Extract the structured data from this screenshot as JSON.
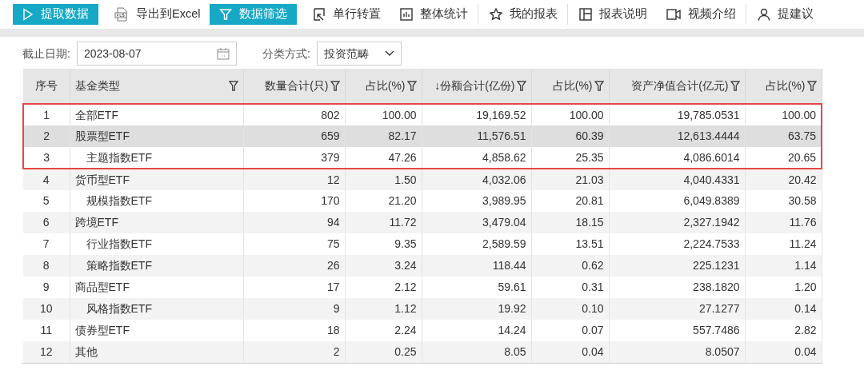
{
  "toolbar": [
    {
      "label": "提取数据",
      "kind": "primary",
      "divider_after": false
    },
    {
      "label": "导出到Excel",
      "kind": "plain",
      "divider_after": false
    },
    {
      "label": "数据筛选",
      "kind": "primary",
      "divider_after": false
    },
    {
      "label": "单行转置",
      "kind": "plain",
      "divider_after": false
    },
    {
      "label": "整体统计",
      "kind": "plain",
      "divider_after": true
    },
    {
      "label": "我的报表",
      "kind": "plain",
      "divider_after": true
    },
    {
      "label": "报表说明",
      "kind": "plain",
      "divider_after": false
    },
    {
      "label": "视频介绍",
      "kind": "plain",
      "divider_after": true
    },
    {
      "label": "提建议",
      "kind": "plain",
      "divider_after": false
    }
  ],
  "filters": {
    "date_label": "截止日期:",
    "date_value": "2023-08-07",
    "category_label": "分类方式:",
    "category_value": "投资范畴"
  },
  "table": {
    "columns": [
      {
        "label": "序号",
        "filter": false
      },
      {
        "label": "基金类型",
        "filter": true
      },
      {
        "label": "数量合计(只)",
        "filter": true
      },
      {
        "label": "占比(%)",
        "filter": true
      },
      {
        "label": "↓份额合计(亿份)",
        "filter": true
      },
      {
        "label": "占比(%)",
        "filter": true
      },
      {
        "label": "资产净值合计(亿元)",
        "filter": true
      },
      {
        "label": "占比(%)",
        "filter": true
      }
    ],
    "rows": [
      {
        "cells": [
          "1",
          "全部ETF",
          "802",
          "100.00",
          "19,169.52",
          "100.00",
          "19,785.0531",
          "100.00"
        ],
        "indented": false,
        "selected": false,
        "boxed": true
      },
      {
        "cells": [
          "2",
          "股票型ETF",
          "659",
          "82.17",
          "11,576.51",
          "60.39",
          "12,613.4444",
          "63.75"
        ],
        "indented": false,
        "selected": true,
        "boxed": true
      },
      {
        "cells": [
          "3",
          "主题指数ETF",
          "379",
          "47.26",
          "4,858.62",
          "25.35",
          "4,086.6014",
          "20.65"
        ],
        "indented": true,
        "selected": false,
        "boxed": true
      },
      {
        "cells": [
          "4",
          "货币型ETF",
          "12",
          "1.50",
          "4,032.06",
          "21.03",
          "4,040.4331",
          "20.42"
        ],
        "indented": false,
        "selected": false,
        "boxed": false
      },
      {
        "cells": [
          "5",
          "规模指数ETF",
          "170",
          "21.20",
          "3,989.95",
          "20.81",
          "6,049.8389",
          "30.58"
        ],
        "indented": true,
        "selected": false,
        "boxed": false
      },
      {
        "cells": [
          "6",
          "跨境ETF",
          "94",
          "11.72",
          "3,479.04",
          "18.15",
          "2,327.1942",
          "11.76"
        ],
        "indented": false,
        "selected": false,
        "boxed": false
      },
      {
        "cells": [
          "7",
          "行业指数ETF",
          "75",
          "9.35",
          "2,589.59",
          "13.51",
          "2,224.7533",
          "11.24"
        ],
        "indented": true,
        "selected": false,
        "boxed": false
      },
      {
        "cells": [
          "8",
          "策略指数ETF",
          "26",
          "3.24",
          "118.44",
          "0.62",
          "225.1231",
          "1.14"
        ],
        "indented": true,
        "selected": false,
        "boxed": false
      },
      {
        "cells": [
          "9",
          "商品型ETF",
          "17",
          "2.12",
          "59.61",
          "0.31",
          "238.1820",
          "1.20"
        ],
        "indented": false,
        "selected": false,
        "boxed": false
      },
      {
        "cells": [
          "10",
          "风格指数ETF",
          "9",
          "1.12",
          "19.92",
          "0.10",
          "27.1277",
          "0.14"
        ],
        "indented": true,
        "selected": false,
        "boxed": false
      },
      {
        "cells": [
          "11",
          "债券型ETF",
          "18",
          "2.24",
          "14.24",
          "0.07",
          "557.7486",
          "2.82"
        ],
        "indented": false,
        "selected": false,
        "boxed": false
      },
      {
        "cells": [
          "12",
          "其他",
          "2",
          "0.25",
          "8.05",
          "0.04",
          "8.0507",
          "0.04"
        ],
        "indented": false,
        "selected": false,
        "boxed": false
      }
    ]
  }
}
